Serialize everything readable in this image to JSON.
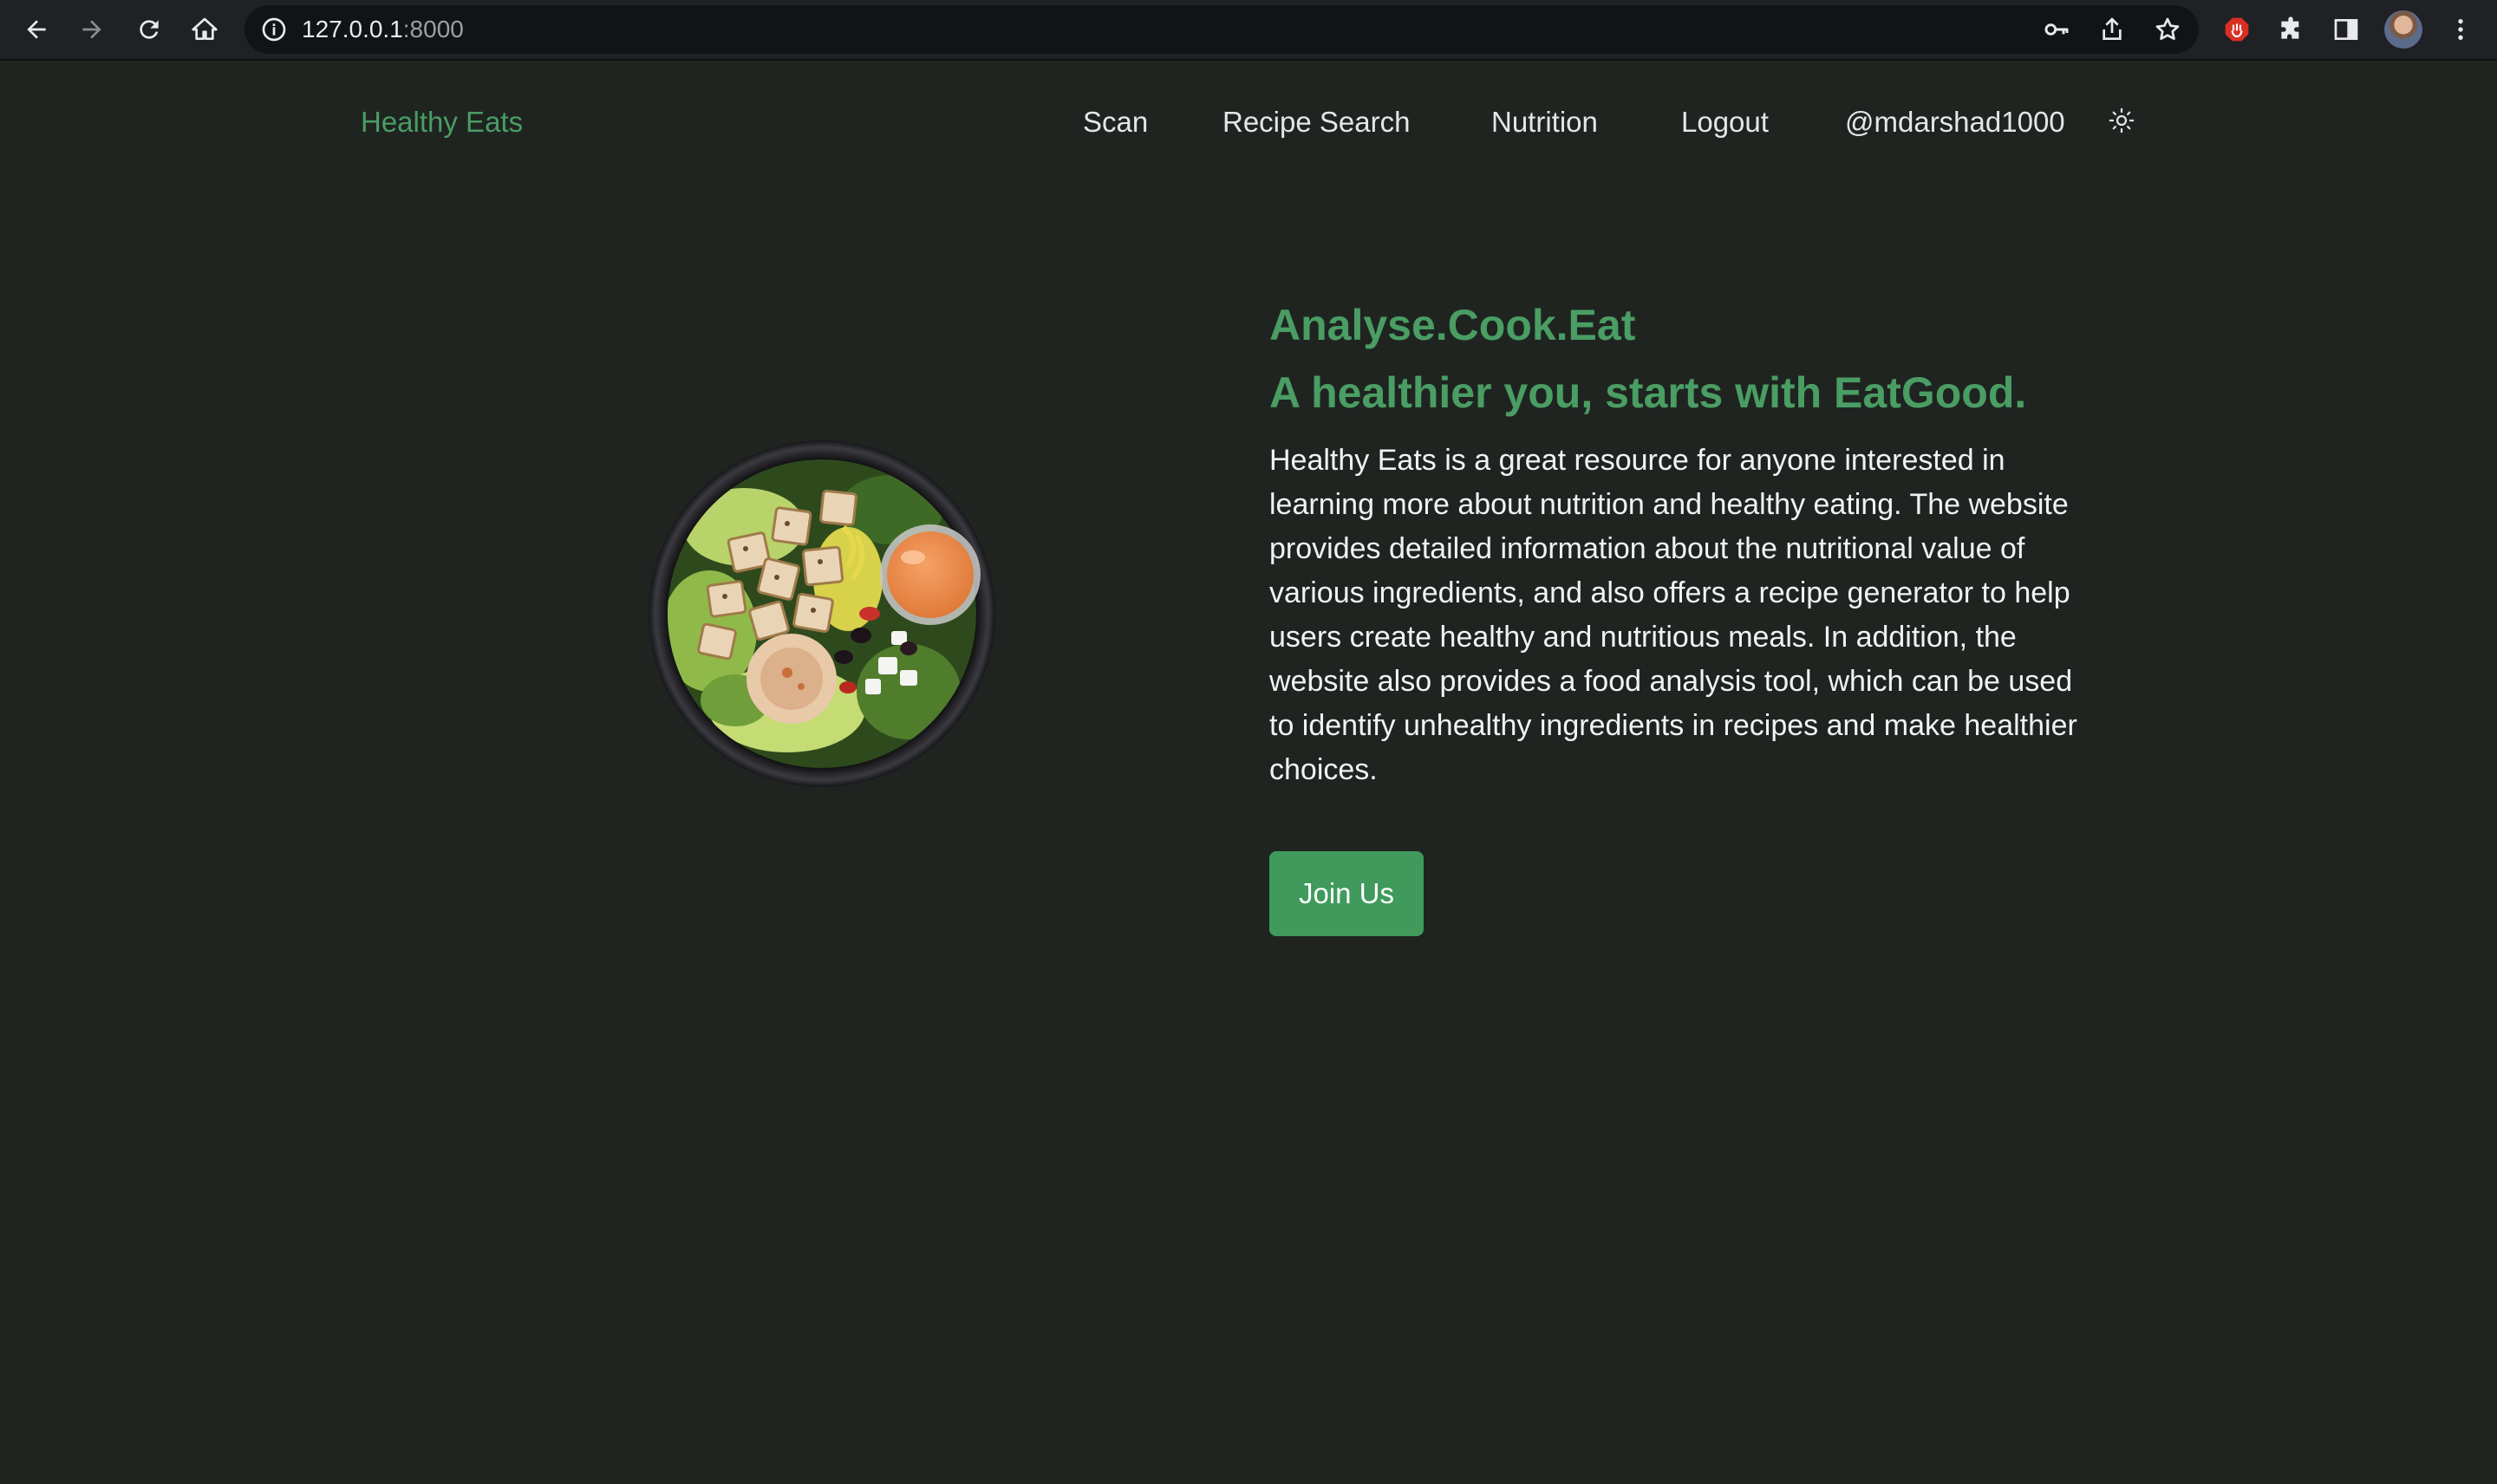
{
  "browser": {
    "url_host": "127.0.0.1",
    "url_port": ":8000"
  },
  "nav": {
    "brand": "Healthy Eats",
    "links": [
      "Scan",
      "Recipe Search",
      "Nutrition",
      "Logout"
    ],
    "username": "@mdarshad1000",
    "theme_icon": "sun-icon"
  },
  "hero": {
    "title_line1": "Analyse.Cook.Eat",
    "title_line2": "A healthier you, starts with EatGood.",
    "description": "Healthy Eats is a great resource for anyone interested in learning more about nutrition and healthy eating. The website provides detailed information about the nutritional value of various ingredients, and also offers a recipe generator to help users create healthy and nutritious meals. In addition, the website also provides a food analysis tool, which can be used to identify unhealthy ingredients in recipes and make healthier choices.",
    "cta": "Join Us",
    "image": "salad-bowl-image"
  },
  "colors": {
    "accent": "#4a9d63",
    "button": "#3f9a5c",
    "background": "#1f2421"
  }
}
